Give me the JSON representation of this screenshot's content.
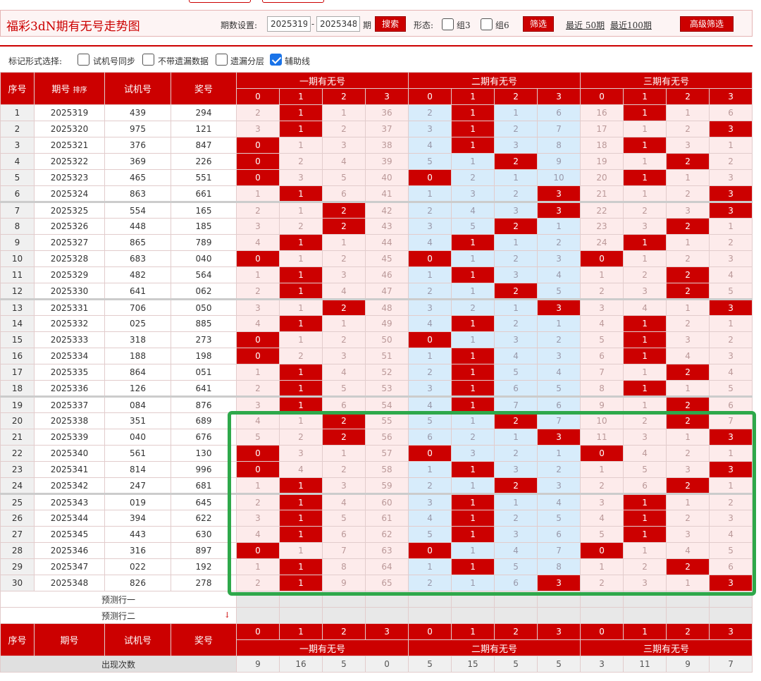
{
  "header": {
    "title": "福彩3dN期有无号走势图",
    "period_label": "期数设置:",
    "period_from": "2025319",
    "period_dash": "-",
    "period_to": "2025348",
    "period_unit": "期",
    "search_label": "搜索",
    "form_label": "形态:",
    "group3_label": "组3",
    "group6_label": "组6",
    "filter_label": "筛选",
    "recent50_label": "最近 50期",
    "recent100_label": "最近100期",
    "advanced_label": "高级筛选"
  },
  "markbar": {
    "label": "标记形式选择:",
    "sync_label": "试机号同步",
    "nomiss_label": "不带遗漏数据",
    "layer_label": "遗漏分层",
    "aux_label": "辅助线",
    "aux_checked": true
  },
  "table": {
    "col_seq": "序号",
    "col_period": "期号",
    "sort_label": "排序",
    "col_trial": "试机号",
    "col_win": "奖号",
    "zone1": "一期有无号",
    "zone2": "二期有无号",
    "zone3": "三期有无号",
    "digits": [
      "0",
      "1",
      "2",
      "3"
    ],
    "rows": [
      {
        "seq": "1",
        "period": "2025319",
        "trial": "439",
        "win": "294",
        "z": [
          [
            "2",
            "1",
            "1",
            "36"
          ],
          [
            "2",
            "1",
            "1",
            "6"
          ],
          [
            "16",
            "1",
            "1",
            "6"
          ]
        ],
        "h": [
          1,
          1,
          1
        ]
      },
      {
        "seq": "2",
        "period": "2025320",
        "trial": "975",
        "win": "121",
        "z": [
          [
            "3",
            "1",
            "2",
            "37"
          ],
          [
            "3",
            "1",
            "2",
            "7"
          ],
          [
            "17",
            "1",
            "2",
            "3"
          ]
        ],
        "h": [
          1,
          1,
          3
        ]
      },
      {
        "seq": "3",
        "period": "2025321",
        "trial": "376",
        "win": "847",
        "z": [
          [
            "0",
            "1",
            "3",
            "38"
          ],
          [
            "4",
            "1",
            "3",
            "8"
          ],
          [
            "18",
            "1",
            "3",
            "1"
          ]
        ],
        "h": [
          0,
          1,
          1
        ]
      },
      {
        "seq": "4",
        "period": "2025322",
        "trial": "369",
        "win": "226",
        "z": [
          [
            "0",
            "2",
            "4",
            "39"
          ],
          [
            "5",
            "1",
            "2",
            "9"
          ],
          [
            "19",
            "1",
            "2",
            "2"
          ]
        ],
        "h": [
          0,
          2,
          2
        ]
      },
      {
        "seq": "5",
        "period": "2025323",
        "trial": "465",
        "win": "551",
        "z": [
          [
            "0",
            "3",
            "5",
            "40"
          ],
          [
            "0",
            "2",
            "1",
            "10"
          ],
          [
            "20",
            "1",
            "1",
            "3"
          ]
        ],
        "h": [
          0,
          0,
          1
        ]
      },
      {
        "seq": "6",
        "period": "2025324",
        "trial": "863",
        "win": "661",
        "z": [
          [
            "1",
            "1",
            "6",
            "41"
          ],
          [
            "1",
            "3",
            "2",
            "3"
          ],
          [
            "21",
            "1",
            "2",
            "3"
          ]
        ],
        "h": [
          1,
          3,
          3
        ]
      },
      {
        "seq": "7",
        "period": "2025325",
        "trial": "554",
        "win": "165",
        "z": [
          [
            "2",
            "1",
            "2",
            "42"
          ],
          [
            "2",
            "4",
            "3",
            "3"
          ],
          [
            "22",
            "2",
            "3",
            "3"
          ]
        ],
        "h": [
          2,
          3,
          3
        ]
      },
      {
        "seq": "8",
        "period": "2025326",
        "trial": "448",
        "win": "185",
        "z": [
          [
            "3",
            "2",
            "2",
            "43"
          ],
          [
            "3",
            "5",
            "2",
            "1"
          ],
          [
            "23",
            "3",
            "2",
            "1"
          ]
        ],
        "h": [
          2,
          2,
          2
        ]
      },
      {
        "seq": "9",
        "period": "2025327",
        "trial": "865",
        "win": "789",
        "z": [
          [
            "4",
            "1",
            "1",
            "44"
          ],
          [
            "4",
            "1",
            "1",
            "2"
          ],
          [
            "24",
            "1",
            "1",
            "2"
          ]
        ],
        "h": [
          1,
          1,
          1
        ]
      },
      {
        "seq": "10",
        "period": "2025328",
        "trial": "683",
        "win": "040",
        "z": [
          [
            "0",
            "1",
            "2",
            "45"
          ],
          [
            "0",
            "1",
            "2",
            "3"
          ],
          [
            "0",
            "1",
            "2",
            "3"
          ]
        ],
        "h": [
          0,
          0,
          0
        ]
      },
      {
        "seq": "11",
        "period": "2025329",
        "trial": "482",
        "win": "564",
        "z": [
          [
            "1",
            "1",
            "3",
            "46"
          ],
          [
            "1",
            "1",
            "3",
            "4"
          ],
          [
            "1",
            "2",
            "2",
            "4"
          ]
        ],
        "h": [
          1,
          1,
          2
        ]
      },
      {
        "seq": "12",
        "period": "2025330",
        "trial": "641",
        "win": "062",
        "z": [
          [
            "2",
            "1",
            "4",
            "47"
          ],
          [
            "2",
            "1",
            "2",
            "5"
          ],
          [
            "2",
            "3",
            "2",
            "5"
          ]
        ],
        "h": [
          1,
          2,
          2
        ]
      },
      {
        "seq": "13",
        "period": "2025331",
        "trial": "706",
        "win": "050",
        "z": [
          [
            "3",
            "1",
            "2",
            "48"
          ],
          [
            "3",
            "2",
            "1",
            "3"
          ],
          [
            "3",
            "4",
            "1",
            "3"
          ]
        ],
        "h": [
          2,
          3,
          3
        ]
      },
      {
        "seq": "14",
        "period": "2025332",
        "trial": "025",
        "win": "885",
        "z": [
          [
            "4",
            "1",
            "1",
            "49"
          ],
          [
            "4",
            "1",
            "2",
            "1"
          ],
          [
            "4",
            "1",
            "2",
            "1"
          ]
        ],
        "h": [
          1,
          1,
          1
        ]
      },
      {
        "seq": "15",
        "period": "2025333",
        "trial": "318",
        "win": "273",
        "z": [
          [
            "0",
            "1",
            "2",
            "50"
          ],
          [
            "0",
            "1",
            "3",
            "2"
          ],
          [
            "5",
            "1",
            "3",
            "2"
          ]
        ],
        "h": [
          0,
          0,
          1
        ]
      },
      {
        "seq": "16",
        "period": "2025334",
        "trial": "188",
        "win": "198",
        "z": [
          [
            "0",
            "2",
            "3",
            "51"
          ],
          [
            "1",
            "1",
            "4",
            "3"
          ],
          [
            "6",
            "1",
            "4",
            "3"
          ]
        ],
        "h": [
          0,
          1,
          1
        ]
      },
      {
        "seq": "17",
        "period": "2025335",
        "trial": "864",
        "win": "051",
        "z": [
          [
            "1",
            "1",
            "4",
            "52"
          ],
          [
            "2",
            "1",
            "5",
            "4"
          ],
          [
            "7",
            "1",
            "2",
            "4"
          ]
        ],
        "h": [
          1,
          1,
          2
        ]
      },
      {
        "seq": "18",
        "period": "2025336",
        "trial": "126",
        "win": "641",
        "z": [
          [
            "2",
            "1",
            "5",
            "53"
          ],
          [
            "3",
            "1",
            "6",
            "5"
          ],
          [
            "8",
            "1",
            "1",
            "5"
          ]
        ],
        "h": [
          1,
          1,
          1
        ]
      },
      {
        "seq": "19",
        "period": "2025337",
        "trial": "084",
        "win": "876",
        "z": [
          [
            "3",
            "1",
            "6",
            "54"
          ],
          [
            "4",
            "1",
            "7",
            "6"
          ],
          [
            "9",
            "1",
            "2",
            "6"
          ]
        ],
        "h": [
          1,
          1,
          2
        ]
      },
      {
        "seq": "20",
        "period": "2025338",
        "trial": "351",
        "win": "689",
        "z": [
          [
            "4",
            "1",
            "2",
            "55"
          ],
          [
            "5",
            "1",
            "2",
            "7"
          ],
          [
            "10",
            "2",
            "2",
            "7"
          ]
        ],
        "h": [
          2,
          2,
          2
        ]
      },
      {
        "seq": "21",
        "period": "2025339",
        "trial": "040",
        "win": "676",
        "z": [
          [
            "5",
            "2",
            "2",
            "56"
          ],
          [
            "6",
            "2",
            "1",
            "3"
          ],
          [
            "11",
            "3",
            "1",
            "3"
          ]
        ],
        "h": [
          2,
          3,
          3
        ]
      },
      {
        "seq": "22",
        "period": "2025340",
        "trial": "561",
        "win": "130",
        "z": [
          [
            "0",
            "3",
            "1",
            "57"
          ],
          [
            "0",
            "3",
            "2",
            "1"
          ],
          [
            "0",
            "4",
            "2",
            "1"
          ]
        ],
        "h": [
          0,
          0,
          0
        ]
      },
      {
        "seq": "23",
        "period": "2025341",
        "trial": "814",
        "win": "996",
        "z": [
          [
            "0",
            "4",
            "2",
            "58"
          ],
          [
            "1",
            "1",
            "3",
            "2"
          ],
          [
            "1",
            "5",
            "3",
            "3"
          ]
        ],
        "h": [
          0,
          1,
          3
        ]
      },
      {
        "seq": "24",
        "period": "2025342",
        "trial": "247",
        "win": "681",
        "z": [
          [
            "1",
            "1",
            "3",
            "59"
          ],
          [
            "2",
            "1",
            "2",
            "3"
          ],
          [
            "2",
            "6",
            "2",
            "1"
          ]
        ],
        "h": [
          1,
          2,
          2
        ]
      },
      {
        "seq": "25",
        "period": "2025343",
        "trial": "019",
        "win": "645",
        "z": [
          [
            "2",
            "1",
            "4",
            "60"
          ],
          [
            "3",
            "1",
            "1",
            "4"
          ],
          [
            "3",
            "1",
            "1",
            "2"
          ]
        ],
        "h": [
          1,
          1,
          1
        ]
      },
      {
        "seq": "26",
        "period": "2025344",
        "trial": "394",
        "win": "622",
        "z": [
          [
            "3",
            "1",
            "5",
            "61"
          ],
          [
            "4",
            "1",
            "2",
            "5"
          ],
          [
            "4",
            "1",
            "2",
            "3"
          ]
        ],
        "h": [
          1,
          1,
          1
        ]
      },
      {
        "seq": "27",
        "period": "2025345",
        "trial": "443",
        "win": "630",
        "z": [
          [
            "4",
            "1",
            "6",
            "62"
          ],
          [
            "5",
            "1",
            "3",
            "6"
          ],
          [
            "5",
            "1",
            "3",
            "4"
          ]
        ],
        "h": [
          1,
          1,
          1
        ]
      },
      {
        "seq": "28",
        "period": "2025346",
        "trial": "316",
        "win": "897",
        "z": [
          [
            "0",
            "1",
            "7",
            "63"
          ],
          [
            "0",
            "1",
            "4",
            "7"
          ],
          [
            "0",
            "1",
            "4",
            "5"
          ]
        ],
        "h": [
          0,
          0,
          0
        ]
      },
      {
        "seq": "29",
        "period": "2025347",
        "trial": "022",
        "win": "192",
        "z": [
          [
            "1",
            "1",
            "8",
            "64"
          ],
          [
            "1",
            "1",
            "5",
            "8"
          ],
          [
            "1",
            "2",
            "2",
            "6"
          ]
        ],
        "h": [
          1,
          1,
          2
        ]
      },
      {
        "seq": "30",
        "period": "2025348",
        "trial": "826",
        "win": "278",
        "z": [
          [
            "2",
            "1",
            "9",
            "65"
          ],
          [
            "2",
            "1",
            "6",
            "3"
          ],
          [
            "2",
            "3",
            "1",
            "3"
          ]
        ],
        "h": [
          1,
          3,
          3
        ]
      }
    ],
    "pred1": "预测行一",
    "pred2": "预测行二",
    "stat_label": "出现次数",
    "stats": [
      "9",
      "16",
      "5",
      "0",
      "5",
      "15",
      "5",
      "5",
      "3",
      "11",
      "9",
      "7"
    ]
  },
  "colors": {
    "accent": "#cc0000",
    "highlight": "#2ea84a",
    "zone_blue": "#d7ecfb",
    "zone_pink": "#fdebeb"
  }
}
